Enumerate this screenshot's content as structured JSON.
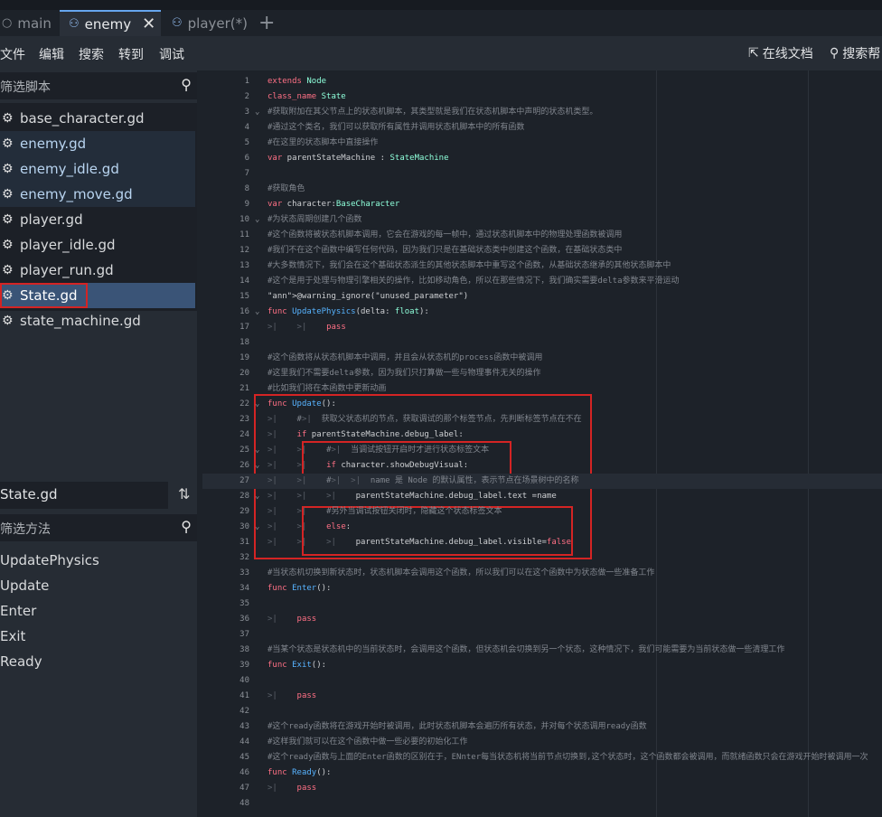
{
  "tabs": [
    {
      "label": "main",
      "icon": "scene-circle-icon"
    },
    {
      "label": "enemy",
      "icon": "node-icon",
      "close": "✕"
    },
    {
      "label": "player(*)",
      "icon": "node-icon"
    }
  ],
  "tab_add": "+",
  "menu": [
    "文件",
    "编辑",
    "搜索",
    "转到",
    "调试"
  ],
  "menu_right": {
    "docs": "在线文档",
    "search_help": "搜索帮"
  },
  "file_filter_placeholder": "筛选脚本",
  "files": [
    "base_character.gd",
    "enemy.gd",
    "enemy_idle.gd",
    "enemy_move.gd",
    "player.gd",
    "player_idle.gd",
    "player_run.gd",
    "State.gd",
    "state_machine.gd"
  ],
  "current_file": "State.gd",
  "method_filter_placeholder": "筛选方法",
  "methods": [
    "UpdatePhysics",
    "Update",
    "Enter",
    "Exit",
    "Ready"
  ],
  "code_lines": [
    "extends Node",
    "class_name State",
    "#获取附加在其父节点上的状态机脚本，其类型就是我们在状态机脚本中声明的状态机类型。",
    "#通过这个类名，我们可以获取所有属性并调用状态机脚本中的所有函数",
    "#在这里的状态脚本中直接操作",
    "var parentStateMachine : StateMachine",
    "",
    "#获取角色",
    "var character:BaseCharacter",
    "#为状态周期创建几个函数",
    "#这个函数将被状态机脚本调用，它会在游戏的每一帧中，通过状态机脚本中的物理处理函数被调用",
    "#我们不在这个函数中编写任何代码，因为我们只是在基础状态类中创建这个函数，在基础状态类中",
    "#大多数情况下，我们会在这个基础状态派生的其他状态脚本中重写这个函数，从基础状态继承的其他状态脚本中",
    "#这个是用于处理与物理引擎相关的操作，比如移动角色，所以在那些情况下，我们确实需要delta参数来平滑运动",
    "@warning_ignore(\"unused_parameter\")",
    "func UpdatePhysics(delta: float):",
    "\t\tpass",
    "",
    "#这个函数将从状态机脚本中调用，并且会从状态机的process函数中被调用",
    "#这里我们不需要delta参数，因为我们只打算做一些与物理事件无关的操作",
    "#比如我们将在本函数中更新动画",
    "func Update():",
    "\t#\t获取父状态机的节点，获取调试的那个标签节点，先判断标签节点在不在",
    "\tif parentStateMachine.debug_label:",
    "\t\t#\t当调试按钮开启时才进行状态标签文本",
    "\t\tif character.showDebugVisual:",
    "\t\t#\t\tname 是 Node 的默认属性，表示节点在场景树中的名称",
    "\t\t\tparentStateMachine.debug_label.text =name",
    "\t\t#另外当调试按钮关闭时，隐藏这个状态标签文本",
    "\t\telse:",
    "\t\t\tparentStateMachine.debug_label.visible=false",
    "",
    "#当状态机切换到新状态时，状态机脚本会调用这个函数，所以我们可以在这个函数中为状态做一些准备工作",
    "func Enter():",
    "",
    "\tpass",
    "",
    "#当某个状态是状态机中的当前状态时，会调用这个函数，但状态机会切换到另一个状态，这种情况下，我们可能需要为当前状态做一些清理工作",
    "func Exit():",
    "",
    "\tpass",
    "",
    "#这个ready函数将在游戏开始时被调用，此时状态机脚本会遍历所有状态，并对每个状态调用ready函数",
    "#这样我们就可以在这个函数中做一些必要的初始化工作",
    "#这个ready函数与上面的Enter函数的区别在于，ENnter每当状态机将当前节点切换到,这个状态时，这个函数都会被调用，而就绪函数只会在游戏开始时被调用一次",
    "func Ready():",
    "\tpass",
    ""
  ]
}
